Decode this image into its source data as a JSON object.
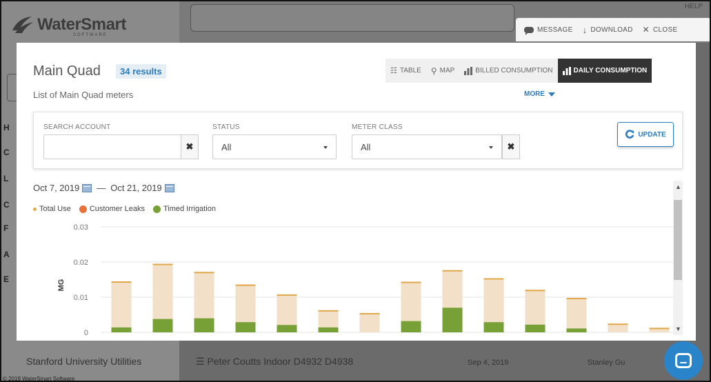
{
  "background": {
    "logo_text": "WaterSmart",
    "logo_sub": "SOFTWARE",
    "help_label": "HELP",
    "row": {
      "name": "Stanford University Utilities",
      "meter": "Peter Coutts Indoor D4932 D4938",
      "date": "Sep 4, 2019",
      "user": "Stanley Gu"
    },
    "footer": "© 2019 WaterSmart Software"
  },
  "topbar": {
    "message_label": "MESSAGE",
    "download_label": "DOWNLOAD",
    "close_label": "CLOSE"
  },
  "modal": {
    "title": "Main Quad",
    "results_badge": "34 results",
    "subtitle": "List of Main Quad meters",
    "more_label": "MORE",
    "view_tabs": [
      {
        "label": "TABLE",
        "icon": "table-icon",
        "active": false
      },
      {
        "label": "MAP",
        "icon": "map-pin-icon",
        "active": false
      },
      {
        "label": "BILLED CONSUMPTION",
        "icon": "bar-chart-icon",
        "active": false
      },
      {
        "label": "DAILY CONSUMPTION",
        "icon": "bar-chart-icon",
        "active": true
      }
    ],
    "filters": {
      "search_label": "SEARCH ACCOUNT",
      "search_value": "",
      "status_label": "STATUS",
      "status_value": "All",
      "meter_class_label": "METER CLASS",
      "meter_class_value": "All",
      "update_label": "UPDATE"
    },
    "date_start": "Oct 7, 2019",
    "date_separator": "—",
    "date_end": "Oct 21, 2019"
  },
  "colors": {
    "accent": "#2a7bbf",
    "total_use": "#e0a84b",
    "customer_leaks": "#e8733a",
    "timed_irrigation": "#77a036",
    "bar_total_fill": "#f3e0c8"
  },
  "chart_data": {
    "type": "bar",
    "stacked": true,
    "legend": [
      "Total Use",
      "Customer Leaks",
      "Timed Irrigation"
    ],
    "ylabel": "MG",
    "ylim": [
      0,
      0.03
    ],
    "yticks": [
      "0",
      "0.01",
      "0.02",
      "0.03"
    ],
    "grid": true,
    "series": [
      {
        "name": "Total Use",
        "values": [
          0.0145,
          0.0195,
          0.0172,
          0.0136,
          0.0108,
          0.0063,
          0.0055,
          0.0144,
          0.0177,
          0.0154,
          0.0121,
          0.0098,
          0.0025,
          0.0013
        ]
      },
      {
        "name": "Timed Irrigation",
        "values": [
          0.0014,
          0.0038,
          0.004,
          0.0029,
          0.0021,
          0.0014,
          0.0,
          0.0032,
          0.007,
          0.0029,
          0.0022,
          0.0011,
          0.0,
          0.0
        ]
      }
    ]
  }
}
